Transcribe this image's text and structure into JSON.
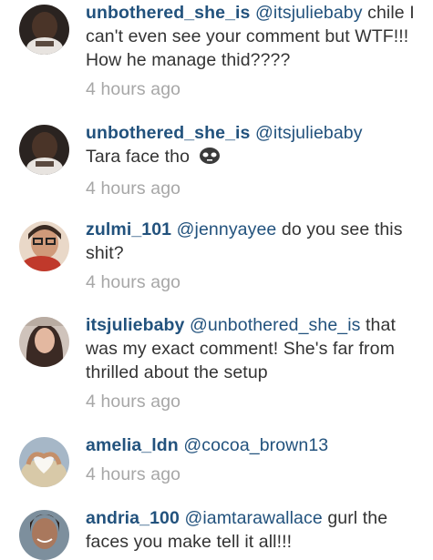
{
  "comments": [
    {
      "username": "unbothered_she_is",
      "mention": "@itsjuliebaby",
      "text": "chile I can't even see your comment but WTF!!! How he manage thid????",
      "time": "4 hours ago",
      "avatar": "dark-selfie-avatar"
    },
    {
      "username": "unbothered_she_is",
      "mention": "@itsjuliebaby",
      "text": "Tara face tho",
      "emoji": "alien-face-emoji",
      "time": "4 hours ago",
      "avatar": "dark-selfie-avatar"
    },
    {
      "username": "zulmi_101",
      "mention": "@jennyayee",
      "text": "do you see this shit?",
      "time": "4 hours ago",
      "avatar": "red-glasses-avatar"
    },
    {
      "username": "itsjuliebaby",
      "mention": "@unbothered_she_is",
      "text": "that was my exact comment! She's far from thrilled about the setup",
      "time": "4 hours ago",
      "avatar": "long-hair-avatar"
    },
    {
      "username": "amelia_ldn",
      "mention": "@cocoa_brown13",
      "text": "",
      "time": "4 hours ago",
      "avatar": "heart-hands-avatar"
    },
    {
      "username": "andria_100",
      "mention": "@iamtarawallace",
      "text": "gurl the faces you make tell it all!!!",
      "time": "",
      "avatar": "smiling-woman-avatar"
    }
  ]
}
